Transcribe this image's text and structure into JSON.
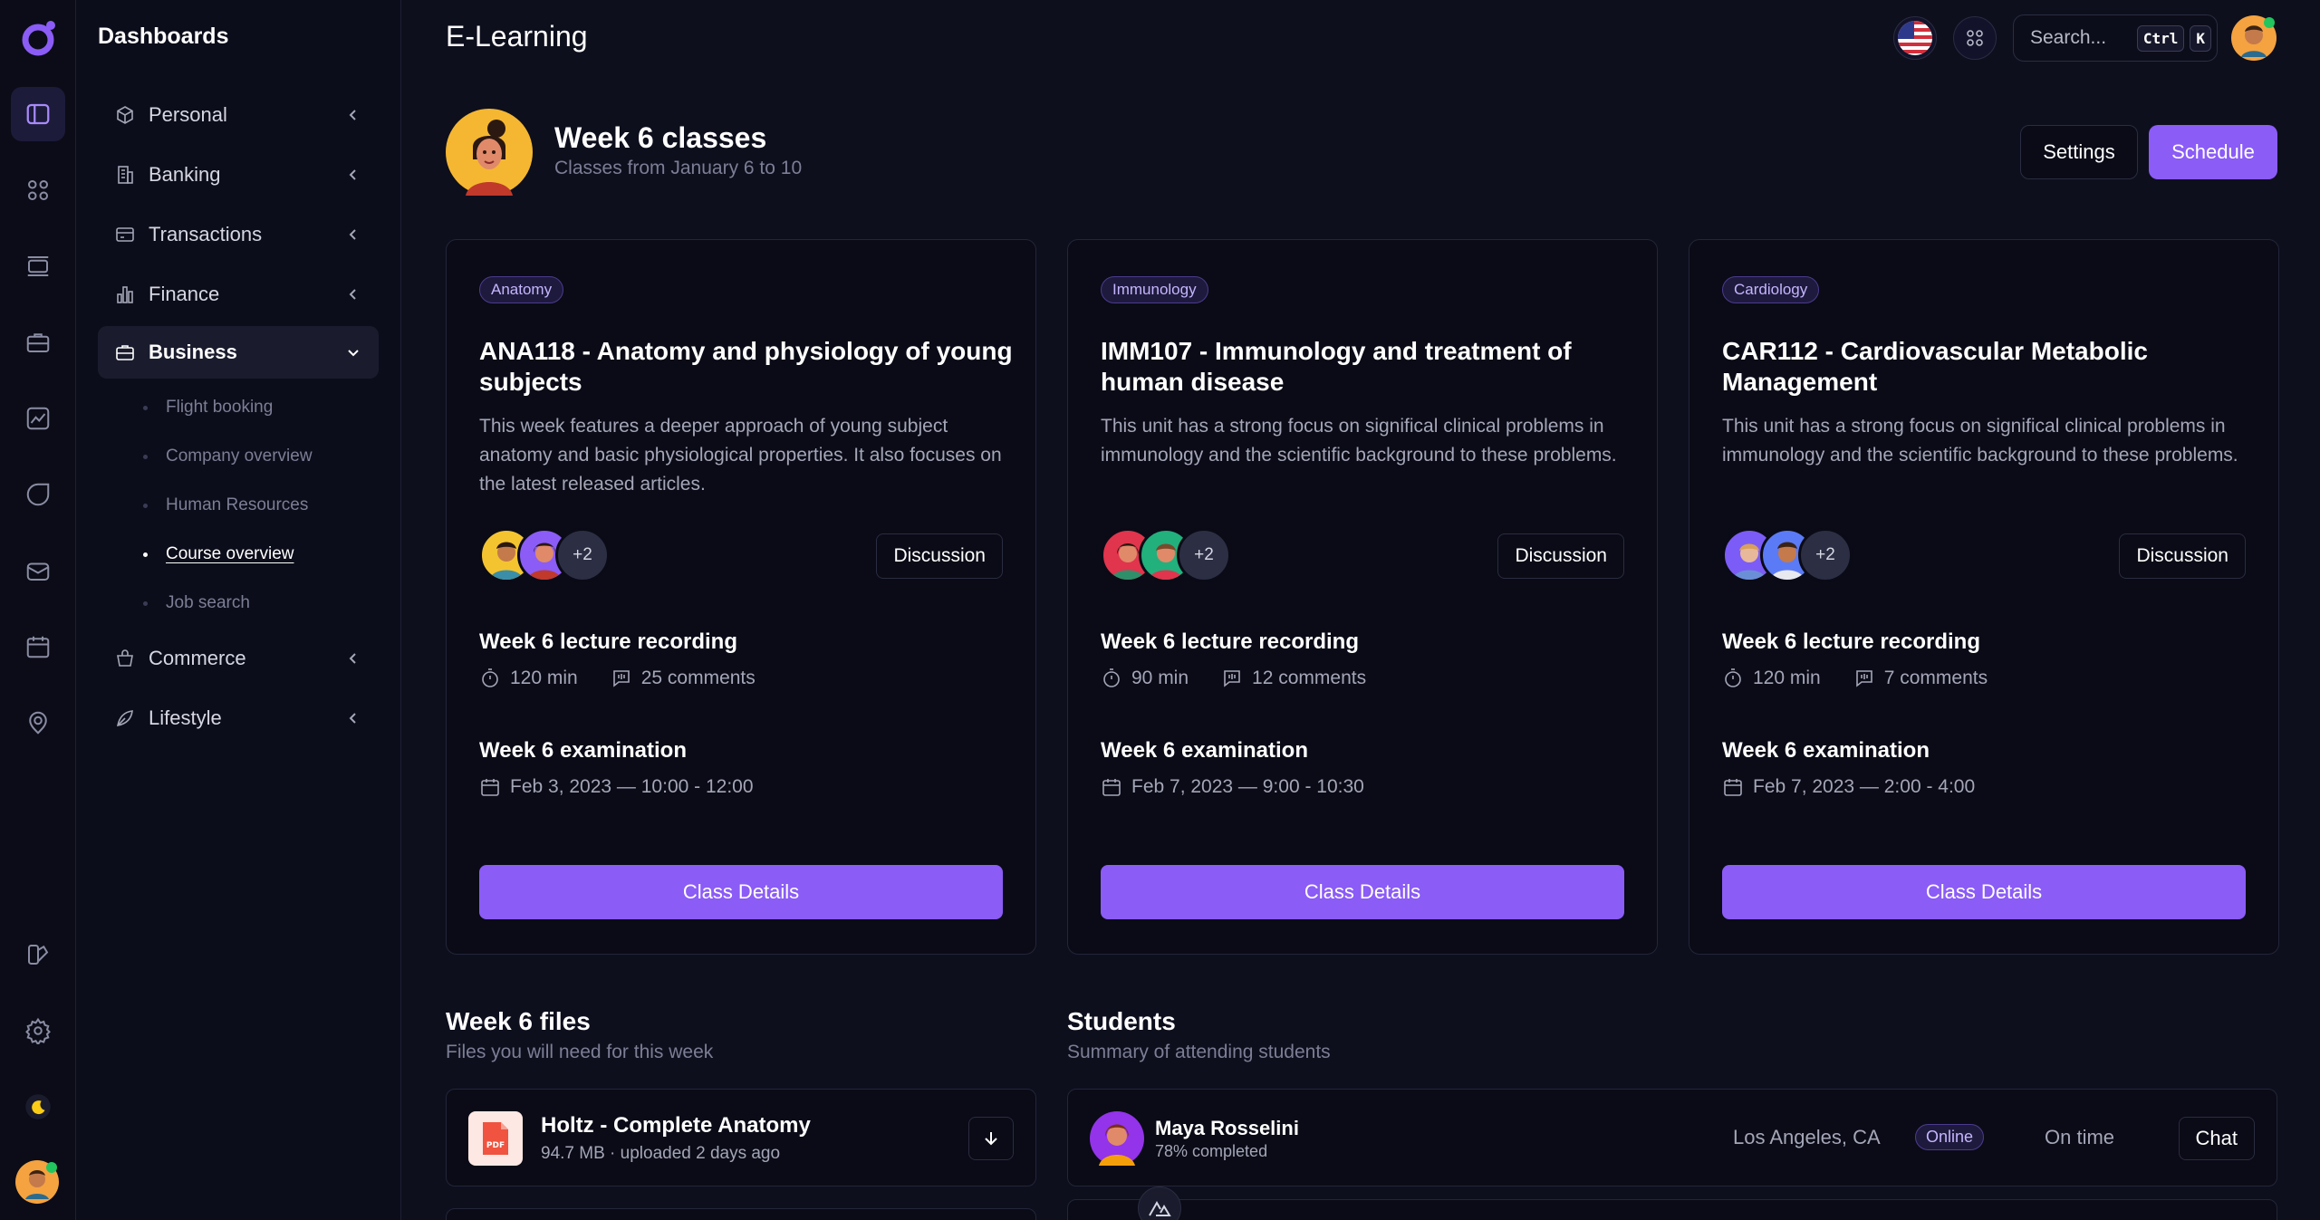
{
  "sidebar": {
    "title": "Dashboards",
    "items": [
      {
        "label": "Personal"
      },
      {
        "label": "Banking"
      },
      {
        "label": "Transactions"
      },
      {
        "label": "Finance"
      },
      {
        "label": "Business"
      },
      {
        "label": "Commerce"
      },
      {
        "label": "Lifestyle"
      }
    ],
    "business_sub": [
      {
        "label": "Flight booking"
      },
      {
        "label": "Company overview"
      },
      {
        "label": "Human Resources"
      },
      {
        "label": "Course overview"
      },
      {
        "label": "Job search"
      }
    ]
  },
  "header": {
    "title": "E-Learning",
    "search_placeholder": "Search...",
    "kbd_ctrl": "Ctrl",
    "kbd_k": "K"
  },
  "week": {
    "title": "Week 6 classes",
    "subtitle": "Classes from January 6 to 10",
    "settings_label": "Settings",
    "schedule_label": "Schedule"
  },
  "courses": [
    {
      "tag": "Anatomy",
      "title": "ANA118 - Anatomy and physiology of young subjects",
      "description": "This week features a deeper approach of young subject anatomy and basic physiological properties. It also focuses on the latest released articles.",
      "more": "+2",
      "discussion": "Discussion",
      "lecture_title": "Week 6 lecture recording",
      "duration": "120 min",
      "comments": "25 comments",
      "exam_title": "Week 6 examination",
      "exam_date": "Feb 3, 2023 — 10:00 - 12:00",
      "details": "Class Details"
    },
    {
      "tag": "Immunology",
      "title": "IMM107 - Immunology and treatment of human disease",
      "description": "This unit has a strong focus on significal clinical problems in immunology and the scientific background to these problems.",
      "more": "+2",
      "discussion": "Discussion",
      "lecture_title": "Week 6 lecture recording",
      "duration": "90 min",
      "comments": "12 comments",
      "exam_title": "Week 6 examination",
      "exam_date": "Feb 7, 2023 — 9:00 - 10:30",
      "details": "Class Details"
    },
    {
      "tag": "Cardiology",
      "title": "CAR112 - Cardiovascular Metabolic Management",
      "description": "This unit has a strong focus on significal clinical problems in immunology and the scientific background to these problems.",
      "more": "+2",
      "discussion": "Discussion",
      "lecture_title": "Week 6 lecture recording",
      "duration": "120 min",
      "comments": "7 comments",
      "exam_title": "Week 6 examination",
      "exam_date": "Feb 7, 2023 — 2:00 - 4:00",
      "details": "Class Details"
    }
  ],
  "files": {
    "title": "Week 6 files",
    "subtitle": "Files you will need for this week",
    "items": [
      {
        "name": "Holtz - Complete Anatomy",
        "meta": "94.7 MB · uploaded 2 days ago",
        "icon": "pdf-icon"
      }
    ]
  },
  "students": {
    "title": "Students",
    "subtitle": "Summary of attending students",
    "items": [
      {
        "name": "Maya Rosselini",
        "progress": "78% completed",
        "location": "Los Angeles, CA",
        "status": "Online",
        "time": "On time",
        "chat": "Chat"
      }
    ]
  },
  "colors": {
    "accent": "#8b5cf6",
    "background": "#0e0f1d",
    "card": "#0a0b16"
  }
}
